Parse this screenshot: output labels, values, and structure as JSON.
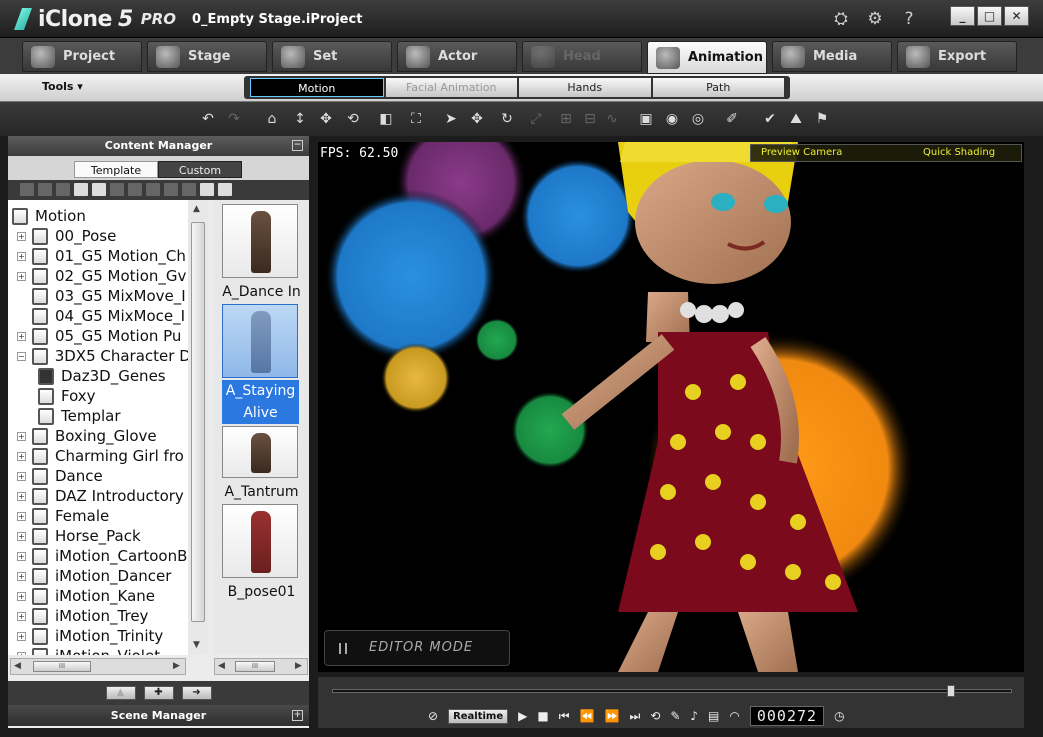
{
  "app": {
    "name": "iClone",
    "version": "5",
    "edition": "PRO",
    "document": "0_Empty Stage.iProject"
  },
  "titlebar": {
    "icons": [
      "render-icon",
      "gear-icon",
      "help-icon"
    ],
    "help_glyph": "?",
    "window_buttons": [
      "_",
      "□",
      "✕"
    ]
  },
  "main_tabs": [
    {
      "label": "Project",
      "state": "normal"
    },
    {
      "label": "Stage",
      "state": "normal"
    },
    {
      "label": "Set",
      "state": "normal"
    },
    {
      "label": "Actor",
      "state": "normal"
    },
    {
      "label": "Head",
      "state": "disabled"
    },
    {
      "label": "Animation",
      "state": "active"
    },
    {
      "label": "Media",
      "state": "normal"
    },
    {
      "label": "Export",
      "state": "normal"
    }
  ],
  "subbar": {
    "tools_label": "Tools ▾",
    "tabs": [
      {
        "label": "Motion",
        "state": "active"
      },
      {
        "label": "Facial Animation",
        "state": "disabled"
      },
      {
        "label": "Hands",
        "state": "normal"
      },
      {
        "label": "Path",
        "state": "normal"
      }
    ]
  },
  "content_manager": {
    "title": "Content Manager",
    "pin": "−",
    "tabs": [
      "Template",
      "Custom"
    ],
    "tree": [
      {
        "label": "Motion",
        "level": 0,
        "expander": ""
      },
      {
        "label": "00_Pose",
        "level": 1,
        "expander": "+"
      },
      {
        "label": "01_G5 Motion_Ch",
        "level": 1,
        "expander": "+"
      },
      {
        "label": "02_G5 Motion_Gv",
        "level": 1,
        "expander": "+"
      },
      {
        "label": "03_G5 MixMove_I",
        "level": 1,
        "expander": ""
      },
      {
        "label": "04_G5 MixMoce_I",
        "level": 1,
        "expander": ""
      },
      {
        "label": "05_G5 Motion Pu",
        "level": 1,
        "expander": "+"
      },
      {
        "label": "3DX5 Character D",
        "level": 1,
        "expander": "−"
      },
      {
        "label": "Daz3D_Genes",
        "level": 2,
        "expander": "",
        "dark": true
      },
      {
        "label": "Foxy",
        "level": 2,
        "expander": ""
      },
      {
        "label": "Templar",
        "level": 2,
        "expander": ""
      },
      {
        "label": "Boxing_Glove",
        "level": 1,
        "expander": "+"
      },
      {
        "label": "Charming Girl fro",
        "level": 1,
        "expander": "+"
      },
      {
        "label": "Dance",
        "level": 1,
        "expander": "+"
      },
      {
        "label": "DAZ Introductory",
        "level": 1,
        "expander": "+"
      },
      {
        "label": "Female",
        "level": 1,
        "expander": "+"
      },
      {
        "label": "Horse_Pack",
        "level": 1,
        "expander": "+"
      },
      {
        "label": "iMotion_CartoonB",
        "level": 1,
        "expander": "+"
      },
      {
        "label": "iMotion_Dancer",
        "level": 1,
        "expander": "+"
      },
      {
        "label": "iMotion_Kane",
        "level": 1,
        "expander": "+"
      },
      {
        "label": "iMotion_Trey",
        "level": 1,
        "expander": "+"
      },
      {
        "label": "iMotion_Trinity",
        "level": 1,
        "expander": "+"
      },
      {
        "label": "iMotion_Violet",
        "level": 1,
        "expander": "+"
      }
    ],
    "thumbnails": [
      {
        "label": "A_Dance In",
        "selected": false
      },
      {
        "label": "A_Staying Alive",
        "selected": true
      },
      {
        "label": "A_Tantrum",
        "selected": false
      },
      {
        "label": "B_pose01",
        "selected": false
      }
    ],
    "scroll_glyphs": {
      "up": "▲",
      "down": "▼",
      "left": "◀",
      "right": "▶",
      "grip": "III"
    },
    "nav_buttons": [
      "▲",
      "✚",
      "➜"
    ]
  },
  "scene_manager": {
    "title": "Scene Manager",
    "pin": "+"
  },
  "viewport": {
    "fps": "FPS:  62.50",
    "camera": "Preview Camera",
    "shading": "Quick Shading",
    "editor_mode": "EDITOR MODE"
  },
  "timeline": {
    "realtime_label": "Realtime",
    "frame_counter": "000272",
    "playhead_fraction": 0.91
  },
  "colors": {
    "accent": "#2a78e0",
    "overlay_text": "#eeee33",
    "bokeh": [
      "#7a2f7a",
      "#2b88d8",
      "#2aa0e0",
      "#1fa04a",
      "#d4a22a",
      "#f08a14"
    ]
  }
}
